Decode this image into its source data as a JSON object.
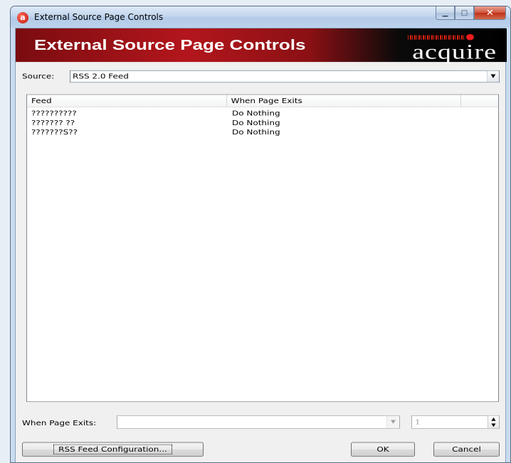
{
  "window": {
    "title": "External Source Page Controls"
  },
  "banner": {
    "title": "External Source Page Controls",
    "brand": "acquire"
  },
  "source": {
    "label": "Source:",
    "selected": "RSS 2.0 Feed"
  },
  "feeds_table": {
    "columns": [
      "Feed",
      "When Page Exits",
      ""
    ],
    "rows": [
      {
        "feed": "??????????",
        "when_page_exits": "Do Nothing"
      },
      {
        "feed": "??????? ??",
        "when_page_exits": "Do Nothing"
      },
      {
        "feed": "???????S??",
        "when_page_exits": "Do Nothing"
      }
    ]
  },
  "when_page_exits": {
    "label": "When Page Exits:",
    "value": "",
    "number": "1"
  },
  "buttons": {
    "rss_config": "RSS Feed Configuration...",
    "ok": "OK",
    "cancel": "Cancel"
  },
  "icons": {
    "app": "acquire-logo-icon",
    "minimize": "minimize-icon",
    "maximize": "maximize-icon",
    "close": "close-icon"
  }
}
